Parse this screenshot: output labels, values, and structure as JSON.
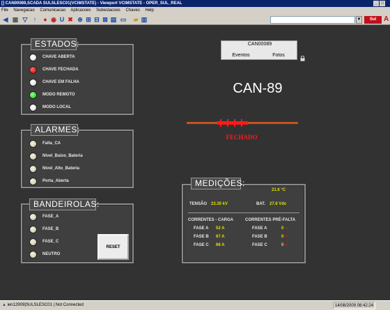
{
  "window": {
    "title": "[] CAN00089,SCADA SULSLESC01(VCIMSTATE) - Viewport VCIMSTATE - OPER_SUL_REAL",
    "menu": [
      "File",
      "Navegacao",
      "Comunicacao",
      "Aplicacoes",
      "Subestacoes",
      "Chaves",
      "Help"
    ],
    "address_value": "",
    "sul_button": "Sul",
    "letter_a": "A"
  },
  "equipment": {
    "id": "CAN00089",
    "tab_eventos": "Eventos",
    "tab_fotos": "Fotos",
    "big_label": "CAN-89"
  },
  "switch": {
    "state_text": "FECHADO",
    "color": "#ff1a1a",
    "line_color": "#c8521e"
  },
  "estados": {
    "title": "ESTADOS:",
    "items": [
      {
        "label": "CHAVE ABERTA",
        "led": "white"
      },
      {
        "label": "CHAVE FECHADA",
        "led": "red"
      },
      {
        "label": "CHAVE EM FALHA",
        "led": "white"
      },
      {
        "label": "MODO REMOTO",
        "led": "green"
      },
      {
        "label": "MODO LOCAL",
        "led": "white"
      }
    ]
  },
  "alarmes": {
    "title": "ALARMES:",
    "items": [
      {
        "label": "Falta_CA",
        "led": "off"
      },
      {
        "label": "Nivel_Baixo_Bateria",
        "led": "off"
      },
      {
        "label": "Nivel_Alto_Bateria",
        "led": "off"
      },
      {
        "label": "Porta_Aberta",
        "led": "off"
      }
    ]
  },
  "bandeirolas": {
    "title": "BANDEIROLAS:",
    "items": [
      {
        "label": "FASE_A",
        "led": "off"
      },
      {
        "label": "FASE_B",
        "led": "off"
      },
      {
        "label": "FASE_C",
        "led": "off"
      },
      {
        "label": "NEUTRO",
        "led": "off"
      }
    ],
    "reset_label": "RESET"
  },
  "medicoes": {
    "title": "MEDIÇÕES:",
    "temperature": "21.6 °C",
    "tensao_label": "TENSÃO",
    "tensao_value": "23.30 kV",
    "bat_label": "BAT.",
    "bat_value": "27.6 Vdc",
    "correntes_carga_title": "CORRENTES - CARGA",
    "correntes_prefalta_title": "CORRENTES PRÉ-FALTA",
    "carga": [
      {
        "fase": "FASE A",
        "value": "52 A"
      },
      {
        "fase": "FASE B",
        "value": "67 A"
      },
      {
        "fase": "FASE C",
        "value": "68 A"
      }
    ],
    "prefalta": [
      {
        "fase": "FASE A",
        "value": "0"
      },
      {
        "fase": "FASE B",
        "value": "0"
      },
      {
        "fase": "FASE C",
        "value": "0"
      }
    ]
  },
  "statusbar": {
    "left": "ien12909|SULSLESC01 | Not Connected",
    "right": "14/08/2009 08:42:24"
  }
}
